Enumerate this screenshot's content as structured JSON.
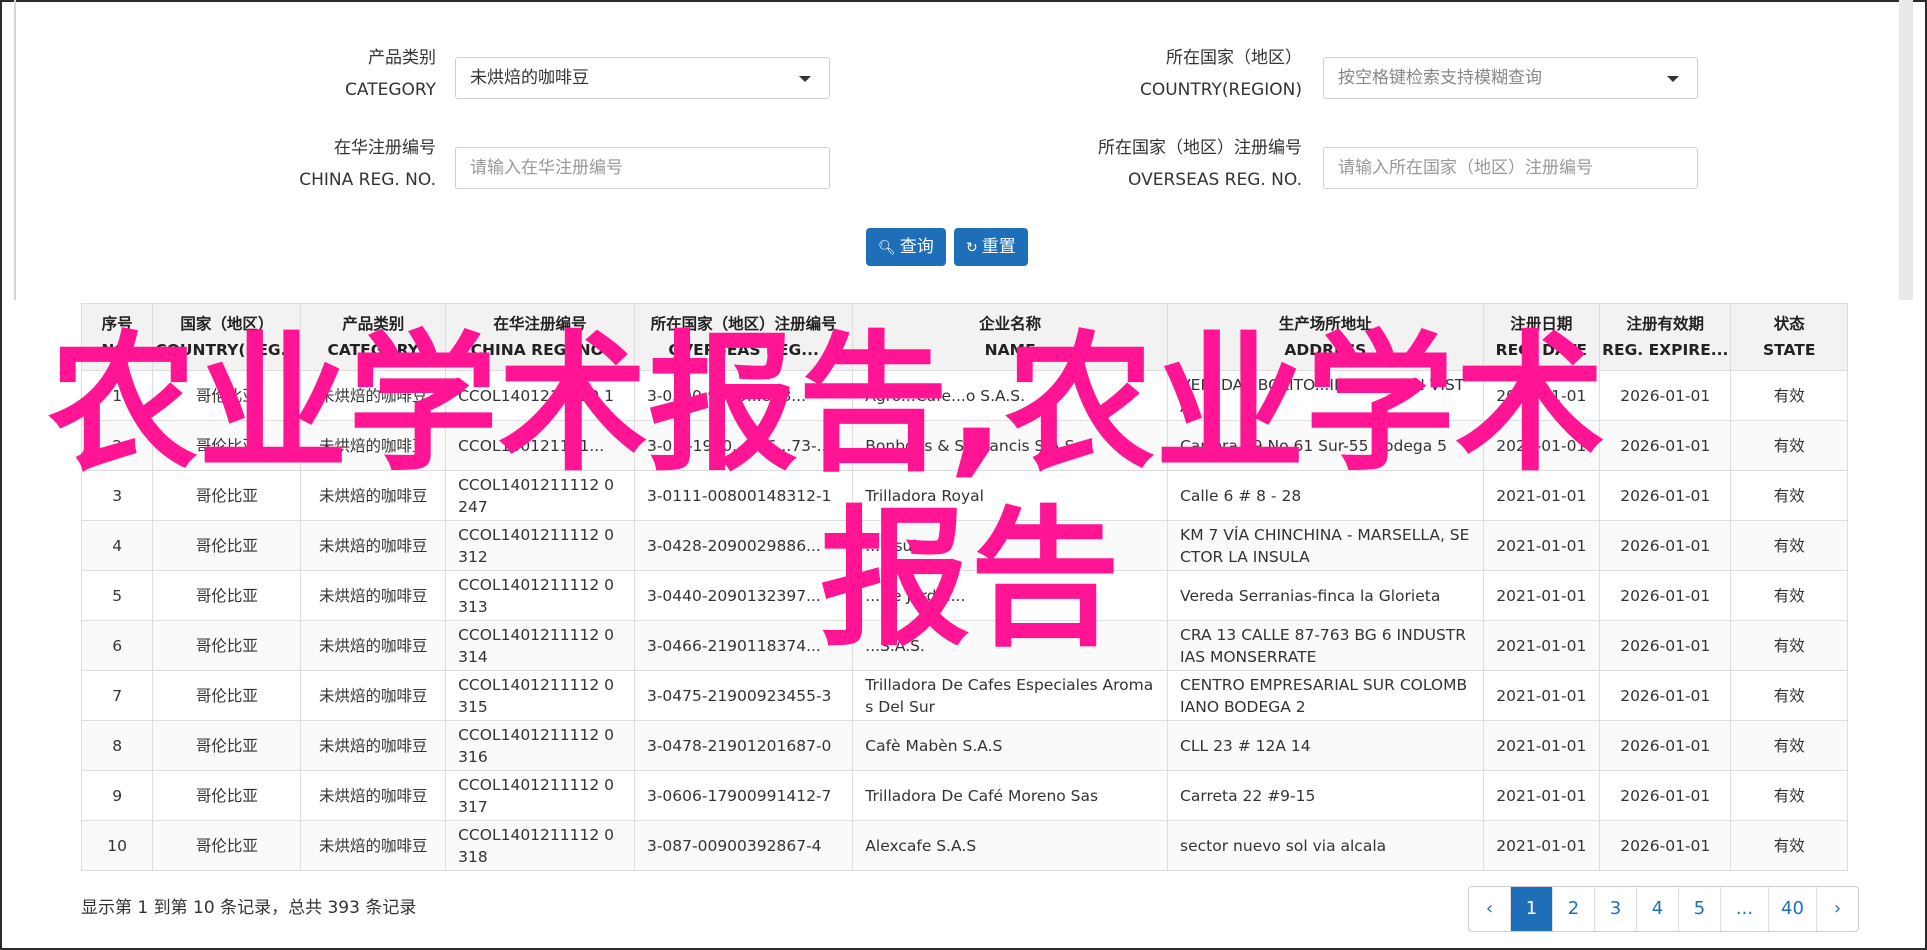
{
  "search": {
    "category": {
      "label_cn": "产品类别",
      "label_en": "CATEGORY",
      "value": "未烘焙的咖啡豆"
    },
    "country": {
      "label_cn": "所在国家（地区）",
      "label_en": "COUNTRY(REGION)",
      "placeholder": "按空格键检索支持模糊查询"
    },
    "china_reg": {
      "label_cn": "在华注册编号",
      "label_en": "CHINA REG. NO.",
      "placeholder": "请输入在华注册编号"
    },
    "overseas_reg": {
      "label_cn": "所在国家（地区）注册编号",
      "label_en": "OVERSEAS REG. NO.",
      "placeholder": "请输入所在国家（地区）注册编号"
    },
    "query_button": "查询",
    "reset_button": "重置"
  },
  "table": {
    "headers": [
      {
        "cn": "序号",
        "en": "NO."
      },
      {
        "cn": "国家（地区）",
        "en": "COUNTRY(REG..."
      },
      {
        "cn": "产品类别",
        "en": "CATEGORY"
      },
      {
        "cn": "在华注册编号",
        "en": "CHINA REG. NO."
      },
      {
        "cn": "所在国家（地区）注册编号",
        "en": "OVERSEAS REG..."
      },
      {
        "cn": "企业名称",
        "en": "NAME"
      },
      {
        "cn": "生产场所地址",
        "en": "ADDRESS"
      },
      {
        "cn": "注册日期",
        "en": "REG. DATE"
      },
      {
        "cn": "注册有效期",
        "en": "REG. EXPIRE..."
      },
      {
        "cn": "状态",
        "en": "STATE"
      }
    ],
    "rows": [
      [
        "1",
        "哥伦比亚",
        "未烘焙的咖啡豆",
        "CCOL1401211120 1",
        "3-0390-9900...868...",
        "Agro...Cafe...o S.A.S.",
        "VEREDA...BOLITO...INCA...BUEN VISTA",
        "2021-01-01",
        "2026-01-01",
        "有效"
      ],
      [
        "2",
        "哥伦比亚",
        "未烘焙的咖啡豆",
        "CCOL140121111...",
        "3-0...-1990...586...73-...",
        "Bonbons & St Francis S.A.S.",
        "Carrera 49 No 61 Sur-55 Bodega 5",
        "2021-01-01",
        "2026-01-01",
        "有效"
      ],
      [
        "3",
        "哥伦比亚",
        "未烘焙的咖啡豆",
        "CCOL1401211112 0247",
        "3-0111-00800148312-1",
        "Trilladora Royal",
        "Calle 6 # 8 - 28",
        "2021-01-01",
        "2026-01-01",
        "有效"
      ],
      [
        "4",
        "哥伦比亚",
        "未烘焙的咖啡豆",
        "CCOL1401211112 0312",
        "3-0428-2090029886...",
        "...Insula...",
        "KM 7 VÍA CHINCHINA - MARSELLA, SECTOR LA INSULA",
        "2021-01-01",
        "2026-01-01",
        "有效"
      ],
      [
        "5",
        "哥伦比亚",
        "未烘焙的咖啡豆",
        "CCOL1401211112 0313",
        "3-0440-2090132397...",
        "...De Jardín...",
        "Vereda Serranias-finca la Glorieta",
        "2021-01-01",
        "2026-01-01",
        "有效"
      ],
      [
        "6",
        "哥伦比亚",
        "未烘焙的咖啡豆",
        "CCOL1401211112 0314",
        "3-0466-2190118374...",
        "...S.A.S.",
        "CRA 13 CALLE 87-763 BG 6 INDUSTRIAS MONSERRATE",
        "2021-01-01",
        "2026-01-01",
        "有效"
      ],
      [
        "7",
        "哥伦比亚",
        "未烘焙的咖啡豆",
        "CCOL1401211112 0315",
        "3-0475-21900923455-3",
        "Trilladora De Cafes Especiales Aromas Del Sur",
        "CENTRO EMPRESARIAL SUR COLOMBIANO BODEGA 2",
        "2021-01-01",
        "2026-01-01",
        "有效"
      ],
      [
        "8",
        "哥伦比亚",
        "未烘焙的咖啡豆",
        "CCOL1401211112 0316",
        "3-0478-21901201687-0",
        "Cafè Mabèn S.A.S",
        "CLL 23 # 12A 14",
        "2021-01-01",
        "2026-01-01",
        "有效"
      ],
      [
        "9",
        "哥伦比亚",
        "未烘焙的咖啡豆",
        "CCOL1401211112 0317",
        "3-0606-17900991412-7",
        "Trilladora De Café Moreno Sas",
        "Carreta 22 #9-15",
        "2021-01-01",
        "2026-01-01",
        "有效"
      ],
      [
        "10",
        "哥伦比亚",
        "未烘焙的咖啡豆",
        "CCOL1401211112 0318",
        "3-087-00900392867-4",
        "Alexcafe S.A.S",
        "sector nuevo sol via alcala",
        "2021-01-01",
        "2026-01-01",
        "有效"
      ]
    ]
  },
  "footer": {
    "summary": "显示第 1 到第 10 条记录，总共 393 条记录",
    "pages": [
      "‹",
      "1",
      "2",
      "3",
      "4",
      "5",
      "...",
      "40",
      "›"
    ],
    "active_page": "1"
  },
  "watermark": {
    "line1": "农业学术报告,农业学术",
    "line2": "报告",
    "color": "#ff1493"
  }
}
